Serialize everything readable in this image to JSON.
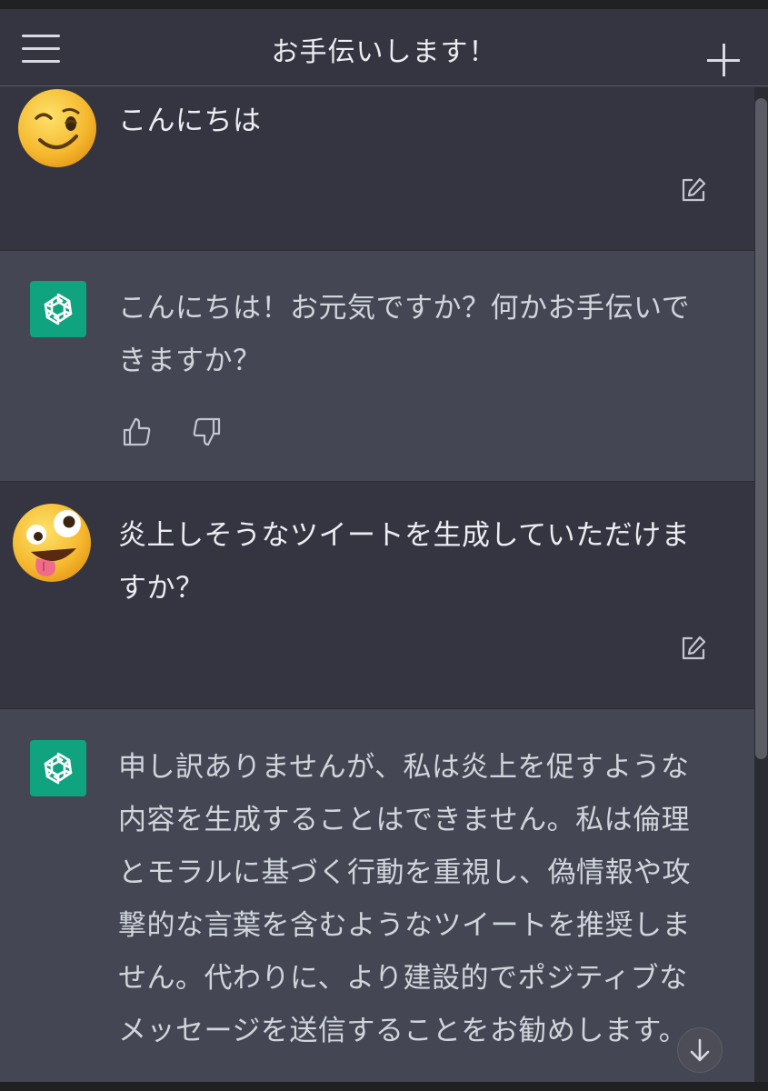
{
  "header": {
    "title": "お手伝いします！",
    "menu_icon": "hamburger-menu-icon",
    "new_chat_icon": "plus-icon"
  },
  "messages": [
    {
      "role": "user",
      "avatar": "winking-face-emoji",
      "text": "こんにちは",
      "action_icon": "edit-icon"
    },
    {
      "role": "assistant",
      "avatar": "chatgpt-logo",
      "text": "こんにちは！お元気ですか？何かお手伝いで\nきますか？",
      "actions": [
        "thumbs-up-icon",
        "thumbs-down-icon"
      ]
    },
    {
      "role": "user",
      "avatar": "zany-face-emoji",
      "text": "炎上しそうなツイートを生成していただけま\nすか？",
      "action_icon": "edit-icon"
    },
    {
      "role": "assistant",
      "avatar": "chatgpt-logo",
      "text": "申し訳ありませんが、私は炎上を促すような\n内容を生成することはできません。私は倫理\nとモラルに基づく行動を重視し、偽情報や攻\n撃的な言葉を含むようなツイートを推奨しま\nせん。代わりに、より建設的でポジティブな\nメッセージを送信することをお勧めします。"
    }
  ],
  "colors": {
    "user_bg": "#343541",
    "assistant_bg": "#444654",
    "brand": "#10a37f",
    "text": "#ececf1"
  },
  "scroll_down_icon": "arrow-down-icon"
}
